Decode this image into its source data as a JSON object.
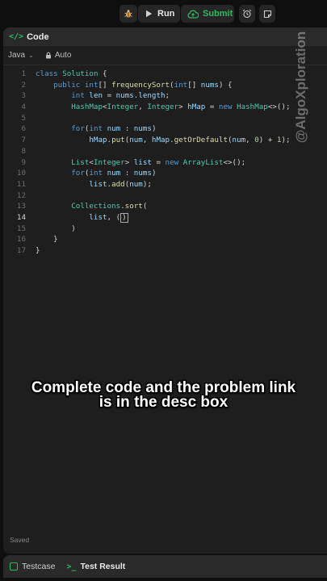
{
  "toolbar": {
    "run_label": "Run",
    "submit_label": "Submit",
    "accent": "#2cbb5d"
  },
  "panel": {
    "title": "Code",
    "language": "Java",
    "auto_label": "Auto",
    "saved_label": "Saved"
  },
  "code": {
    "active_line": 14,
    "lines": [
      {
        "num": "1",
        "text": "class Solution {"
      },
      {
        "num": "2",
        "text": "    public int[] frequencySort(int[] nums) {"
      },
      {
        "num": "3",
        "text": "        int len = nums.length;"
      },
      {
        "num": "4",
        "text": "        HashMap<Integer, Integer> hMap = new HashMap<>();"
      },
      {
        "num": "5",
        "text": ""
      },
      {
        "num": "6",
        "text": "        for(int num : nums)"
      },
      {
        "num": "7",
        "text": "            hMap.put(num, hMap.getOrDefault(num, 0) + 1);"
      },
      {
        "num": "8",
        "text": ""
      },
      {
        "num": "9",
        "text": "        List<Integer> list = new ArrayList<>();"
      },
      {
        "num": "10",
        "text": "        for(int num : nums)"
      },
      {
        "num": "11",
        "text": "            list.add(num);"
      },
      {
        "num": "12",
        "text": ""
      },
      {
        "num": "13",
        "text": "        Collections.sort("
      },
      {
        "num": "14",
        "text": "            list, ()"
      },
      {
        "num": "15",
        "text": "        )"
      },
      {
        "num": "16",
        "text": "    }"
      },
      {
        "num": "17",
        "text": "}"
      }
    ]
  },
  "overlay": {
    "line1": "Complete code and the problem link",
    "line2": "is in the desc box"
  },
  "watermark": "@AlgoXploration",
  "bottom_tabs": {
    "testcase_label": "Testcase",
    "result_label": "Test Result"
  }
}
